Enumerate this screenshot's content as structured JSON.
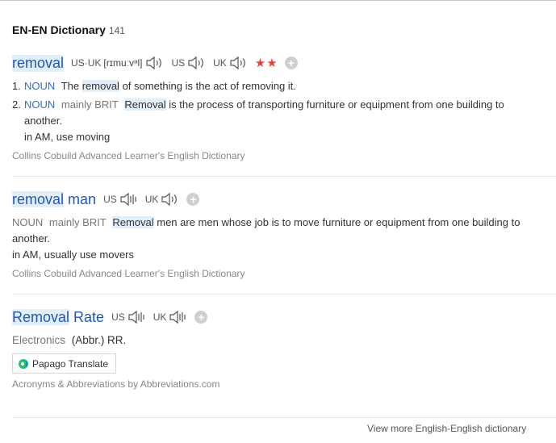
{
  "header": {
    "title": "EN-EN Dictionary",
    "count": "141"
  },
  "entries": [
    {
      "word": "removal",
      "pron": {
        "us_uk_label": "US·UK",
        "phonetic": "[rɪmuːvᵊl]",
        "us_label": "US",
        "uk_label": "UK"
      },
      "stars": "★★",
      "defs": [
        {
          "num": "1.",
          "pos": "NOUN",
          "t1": "The",
          "hl": "removal",
          "t2": "of something is the act of removing it."
        },
        {
          "num": "2.",
          "pos": "NOUN",
          "region": "mainly BRIT",
          "hl": "Removal",
          "t2": "is the process of transporting furniture or equipment from one building to",
          "t3": "another.",
          "note": "in AM, use moving"
        }
      ],
      "source": "Collins Cobuild Advanced Learner's English Dictionary"
    },
    {
      "word_hl": "removal",
      "word_rest": "man",
      "pron": {
        "us_label": "US",
        "uk_label": "UK"
      },
      "def": {
        "pos": "NOUN",
        "region": "mainly BRIT",
        "hl": "Removal",
        "t2": "men are men whose job is to move furniture or equipment from one building to",
        "t3": "another.",
        "note": "in AM, usually use movers"
      },
      "source": "Collins Cobuild Advanced Learner's English Dictionary"
    },
    {
      "word_hl": "Removal",
      "word_rest": "Rate",
      "pron": {
        "us_label": "US",
        "uk_label": "UK"
      },
      "category": "Electronics",
      "abbr": "(Abbr.) RR.",
      "translate_label": "Papago Translate",
      "source": "Acronyms & Abbreviations by Abbreviations.com"
    }
  ],
  "footer_partial": "View more English-English dictionary"
}
